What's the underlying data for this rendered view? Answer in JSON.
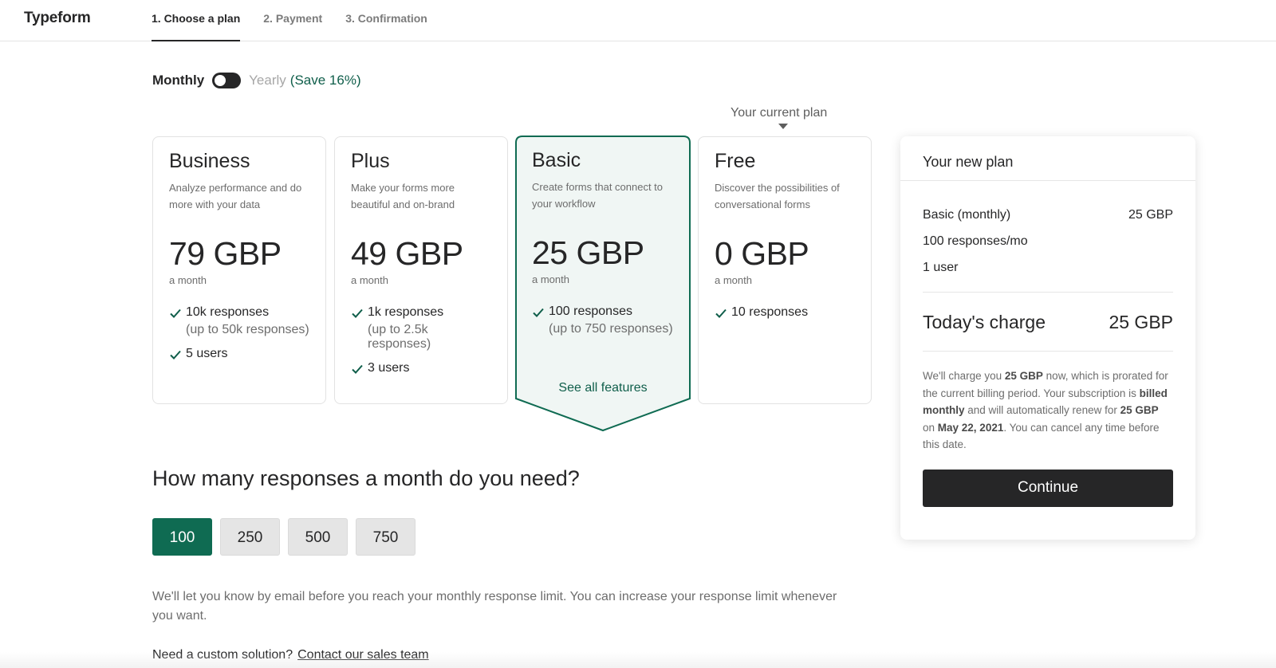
{
  "header": {
    "logo": "Typeform",
    "steps": [
      {
        "label": "1. Choose a plan"
      },
      {
        "label": "2. Payment"
      },
      {
        "label": "3. Confirmation"
      }
    ]
  },
  "billing": {
    "monthly_label": "Monthly",
    "yearly_label": "Yearly",
    "save_label": "(Save 16%)",
    "selected": "Monthly"
  },
  "current_plan_label": "Your current plan",
  "plans": [
    {
      "name": "Business",
      "description": "Analyze performance and do more with your data",
      "price": "79 GBP",
      "period": "a month",
      "features": [
        {
          "text": "10k responses",
          "sub": "(up to 50k responses)"
        },
        {
          "text": "5 users",
          "sub": ""
        }
      ]
    },
    {
      "name": "Plus",
      "description": "Make your forms more beautiful and on-brand",
      "price": "49 GBP",
      "period": "a month",
      "features": [
        {
          "text": "1k responses",
          "sub": "(up to 2.5k responses)"
        },
        {
          "text": "3 users",
          "sub": ""
        }
      ]
    },
    {
      "name": "Basic",
      "description": "Create forms that connect to your workflow",
      "price": "25 GBP",
      "period": "a month",
      "features": [
        {
          "text": "100 responses",
          "sub": "(up to 750 responses)"
        }
      ],
      "link": "See all features",
      "selected": true
    },
    {
      "name": "Free",
      "description": "Discover the possibilities of conversational forms",
      "price": "0 GBP",
      "period": "a month",
      "features": [
        {
          "text": "10 responses",
          "sub": ""
        }
      ]
    }
  ],
  "responses": {
    "title": "How many responses a month do you need?",
    "options": [
      "100",
      "250",
      "500",
      "750"
    ],
    "selected": "100",
    "notice": "We'll let you know by email before you reach your monthly response limit. You can increase your response limit whenever you want.",
    "custom_prefix": "Need a custom solution?",
    "custom_link": "Contact our sales team"
  },
  "summary": {
    "title": "Your new plan",
    "plan_line": "Basic (monthly)",
    "plan_price": "25 GBP",
    "responses_line": "100 responses/mo",
    "users_line": "1 user",
    "charge_label": "Today's charge",
    "charge_value": "25 GBP",
    "note": {
      "p1": "We'll charge you ",
      "b1": "25 GBP",
      "p2": " now, which is prorated for the current billing period. Your subscription is ",
      "b2": "billed monthly",
      "p3": " and will automatically renew for ",
      "b3": "25 GBP",
      "p4": " on ",
      "b4": "May 22, 2021",
      "p5": ". You can cancel any time before this date."
    },
    "continue_label": "Continue"
  },
  "colors": {
    "accent_green": "#0f6b52",
    "dark": "#262627",
    "selected_card_bg": "#f0f6f4"
  }
}
